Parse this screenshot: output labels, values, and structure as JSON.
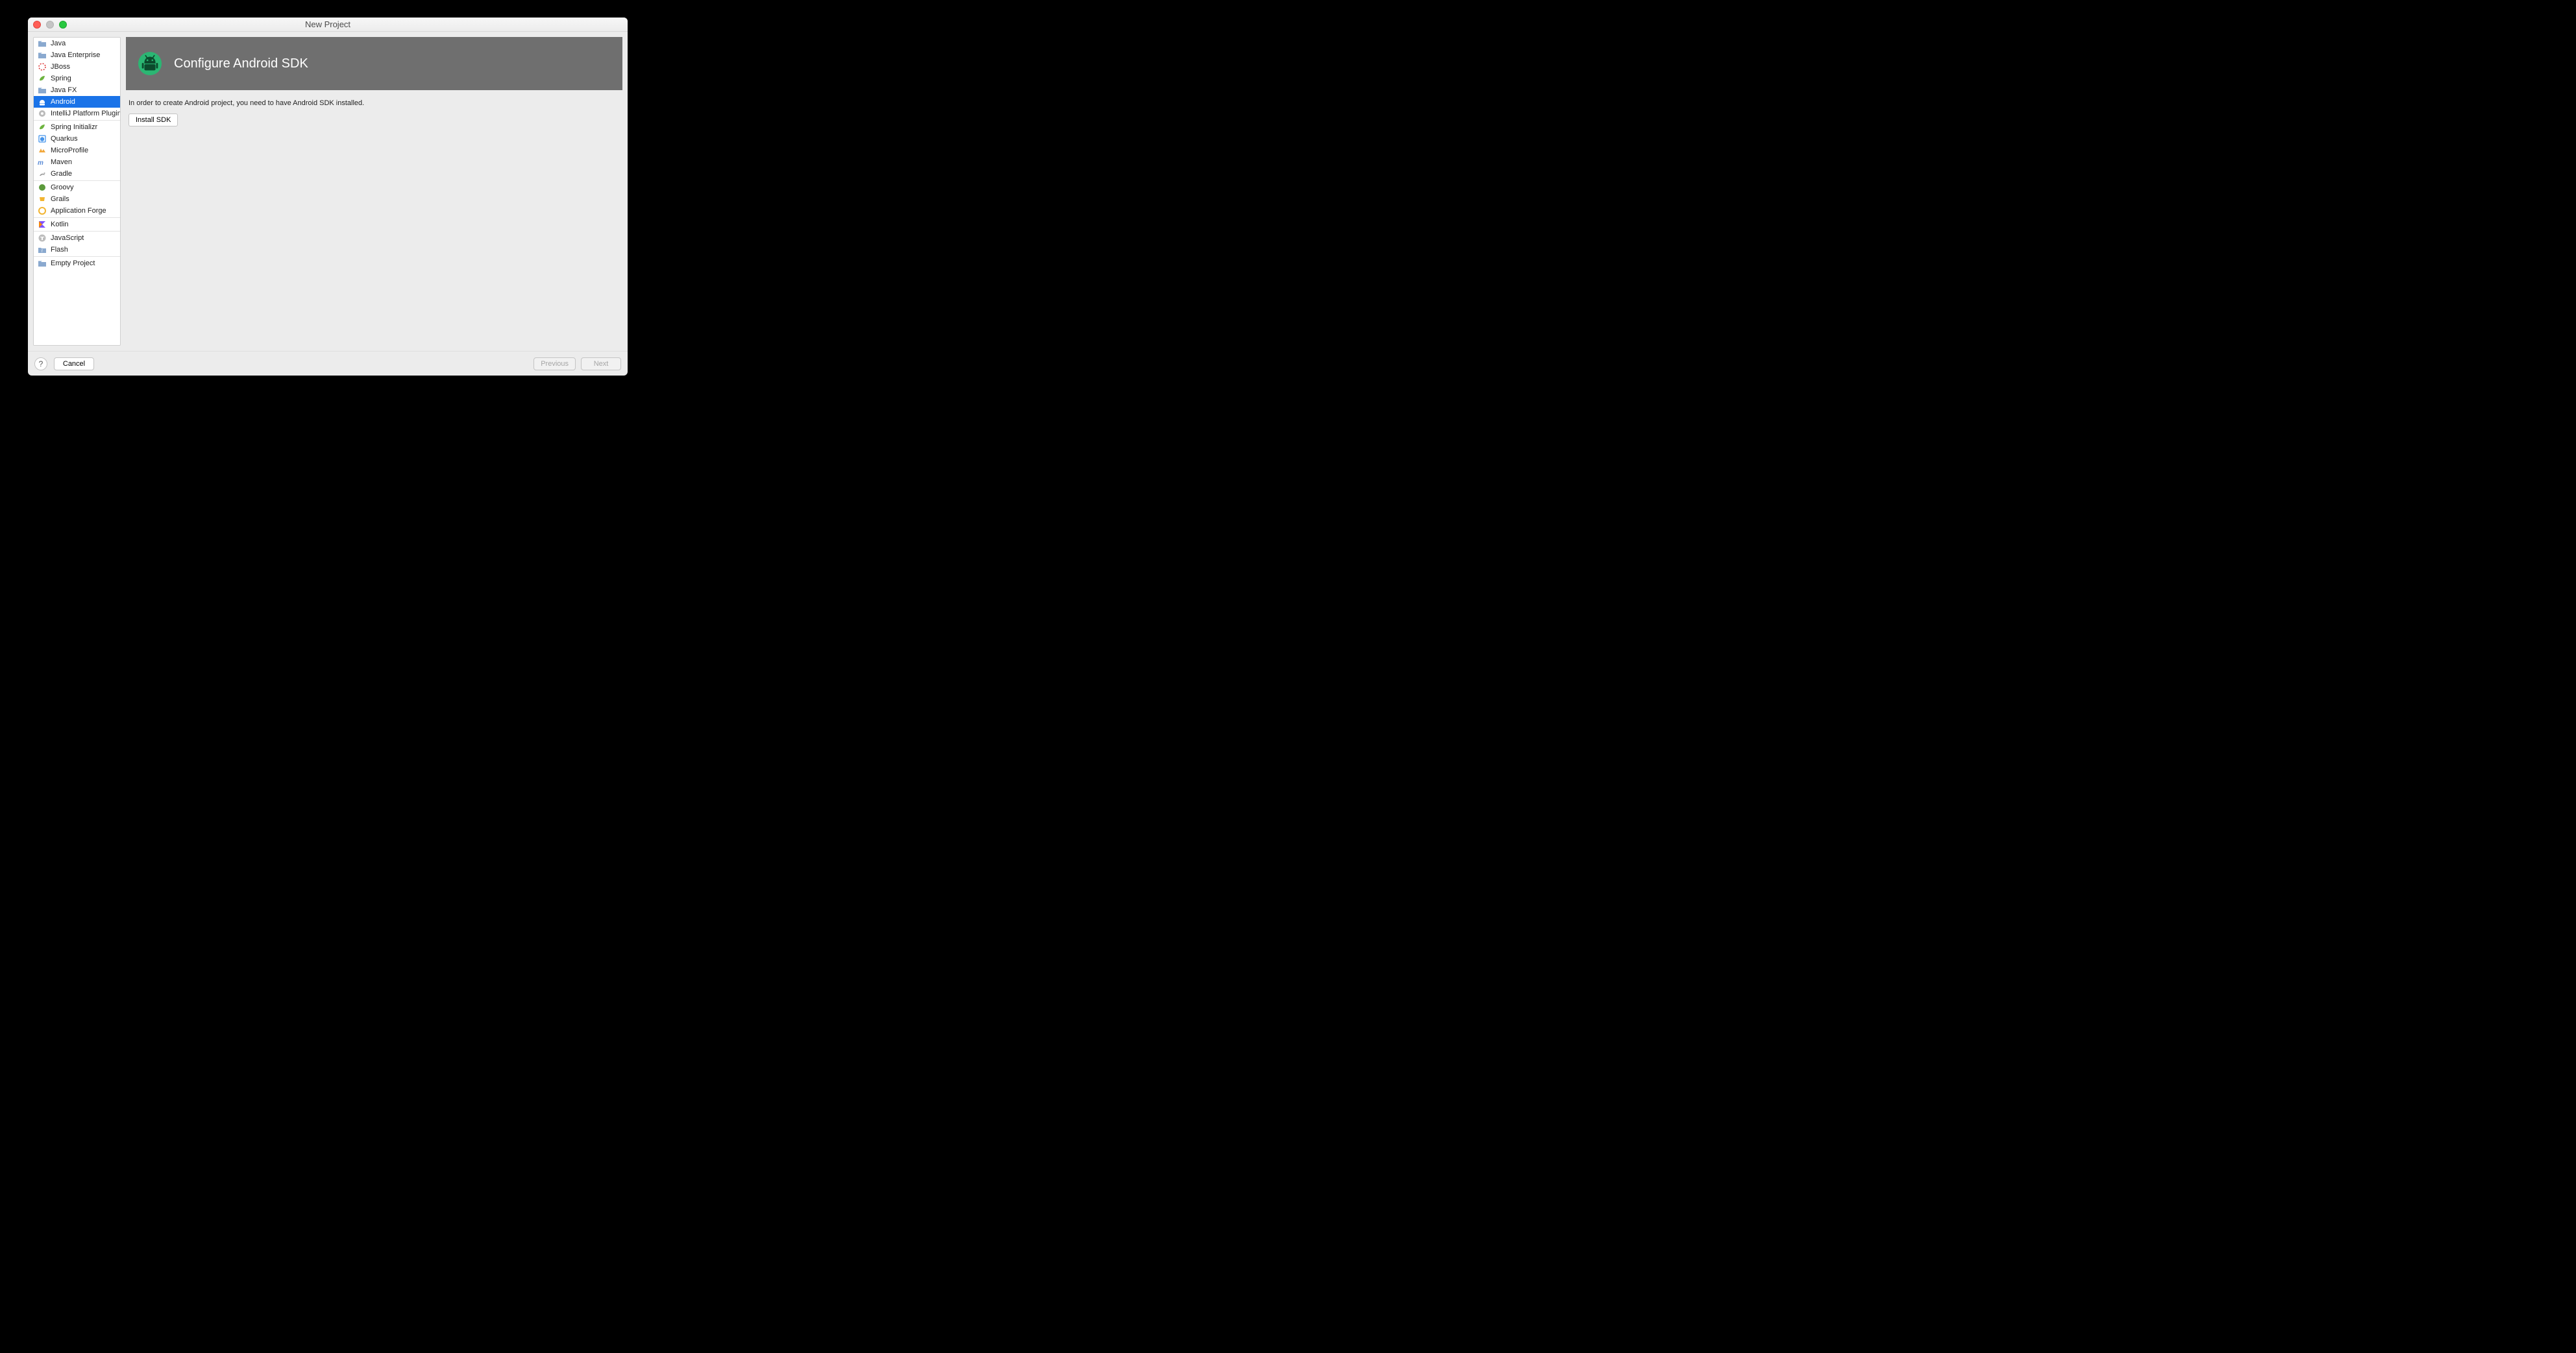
{
  "window": {
    "title": "New Project"
  },
  "sidebar": {
    "groups": [
      [
        {
          "label": "Java",
          "icon": "folder-java",
          "selected": false
        },
        {
          "label": "Java Enterprise",
          "icon": "folder-java",
          "selected": false
        },
        {
          "label": "JBoss",
          "icon": "jboss",
          "selected": false
        },
        {
          "label": "Spring",
          "icon": "spring",
          "selected": false
        },
        {
          "label": "Java FX",
          "icon": "folder",
          "selected": false
        },
        {
          "label": "Android",
          "icon": "android",
          "selected": true
        },
        {
          "label": "IntelliJ Platform Plugin",
          "icon": "intellij",
          "selected": false
        }
      ],
      [
        {
          "label": "Spring Initializr",
          "icon": "spring",
          "selected": false
        },
        {
          "label": "Quarkus",
          "icon": "quarkus",
          "selected": false
        },
        {
          "label": "MicroProfile",
          "icon": "microprofile",
          "selected": false
        },
        {
          "label": "Maven",
          "icon": "maven",
          "selected": false
        },
        {
          "label": "Gradle",
          "icon": "gradle",
          "selected": false
        }
      ],
      [
        {
          "label": "Groovy",
          "icon": "groovy",
          "selected": false
        },
        {
          "label": "Grails",
          "icon": "grails",
          "selected": false
        },
        {
          "label": "Application Forge",
          "icon": "forge",
          "selected": false
        }
      ],
      [
        {
          "label": "Kotlin",
          "icon": "kotlin",
          "selected": false
        }
      ],
      [
        {
          "label": "JavaScript",
          "icon": "javascript",
          "selected": false
        },
        {
          "label": "Flash",
          "icon": "flash",
          "selected": false
        }
      ],
      [
        {
          "label": "Empty Project",
          "icon": "folder",
          "selected": false
        }
      ]
    ]
  },
  "main": {
    "banner_title": "Configure Android SDK",
    "description": "In order to create Android project, you need to have Android SDK installed.",
    "install_label": "Install SDK"
  },
  "footer": {
    "help": "?",
    "cancel": "Cancel",
    "previous": "Previous",
    "next": "Next"
  }
}
